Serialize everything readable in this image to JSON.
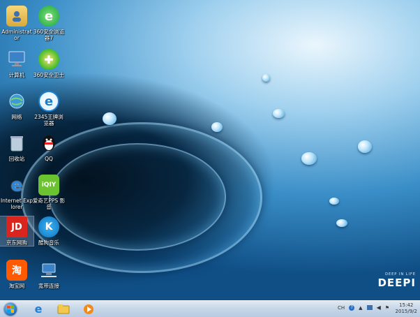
{
  "desktop_icons": [
    {
      "label": "Administrator",
      "icon": "user-folder-icon"
    },
    {
      "label": "360安全浏览器7",
      "icon": "360-browser-icon"
    },
    {
      "label": "计算机",
      "icon": "computer-icon"
    },
    {
      "label": "360安全卫士",
      "icon": "360-safeguard-icon"
    },
    {
      "label": "网络",
      "icon": "network-icon"
    },
    {
      "label": "2345王牌浏览器",
      "icon": "2345-browser-icon"
    },
    {
      "label": "回收站",
      "icon": "recycle-bin-icon"
    },
    {
      "label": "QQ",
      "icon": "qq-icon"
    },
    {
      "label": "Internet Explorer",
      "icon": "internet-explorer-icon"
    },
    {
      "label": "爱奇艺PPS 影音",
      "icon": "iqiyi-icon"
    },
    {
      "label": "京东网购",
      "icon": "jd-icon"
    },
    {
      "label": "酷狗音乐",
      "icon": "kugou-icon"
    },
    {
      "label": "淘宝网",
      "icon": "taobao-icon"
    },
    {
      "label": "宽带连接",
      "icon": "broadband-icon"
    }
  ],
  "wallpaper_brand": {
    "tagline": "DEEP IN LIFE",
    "name": "DEEPI"
  },
  "taskbar": {
    "pinned": [
      "internet-explorer-icon",
      "explorer-folder-icon",
      "media-player-icon"
    ],
    "tray_lang": "CH"
  },
  "clock": {
    "time": "15:42",
    "date": "2015/9/2"
  }
}
